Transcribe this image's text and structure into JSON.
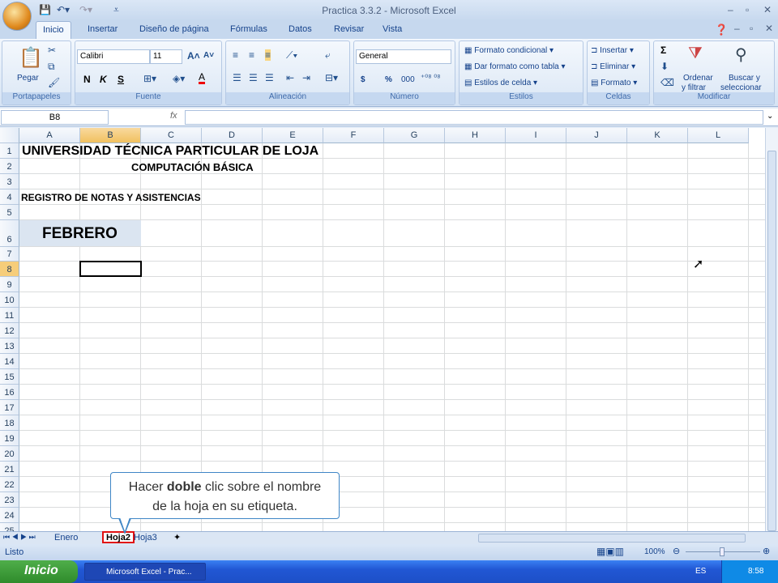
{
  "window": {
    "title": "Practica 3.3.2 - Microsoft Excel"
  },
  "tabs": [
    "Inicio",
    "Insertar",
    "Diseño de página",
    "Fórmulas",
    "Datos",
    "Revisar",
    "Vista"
  ],
  "ribbon": {
    "portapapeles": {
      "label": "Portapapeles",
      "pegar": "Pegar"
    },
    "fuente": {
      "label": "Fuente",
      "font": "Calibri",
      "size": "11",
      "bold": "N",
      "italic": "K",
      "underline": "S"
    },
    "alineacion": {
      "label": "Alineación"
    },
    "numero": {
      "label": "Número",
      "format": "General",
      "currency": "$",
      "percent": "%",
      "thousands": "000"
    },
    "estilos": {
      "label": "Estilos",
      "items": [
        "Formato condicional",
        "Dar formato como tabla",
        "Estilos de celda"
      ]
    },
    "celdas": {
      "label": "Celdas",
      "items": [
        "Insertar",
        "Eliminar",
        "Formato"
      ]
    },
    "modificar": {
      "label": "Modificar",
      "sum": "Σ",
      "ordenar1": "Ordenar",
      "ordenar2": "y filtrar",
      "buscar1": "Buscar y",
      "buscar2": "seleccionar"
    }
  },
  "formula_bar": {
    "name_box": "B8",
    "fx": "fx",
    "value": ""
  },
  "columns": [
    "A",
    "B",
    "C",
    "D",
    "E",
    "F",
    "G",
    "H",
    "I",
    "J",
    "K",
    "L"
  ],
  "rows": [
    "1",
    "2",
    "3",
    "4",
    "5",
    "6",
    "7",
    "8",
    "9",
    "10",
    "11",
    "12",
    "13",
    "14",
    "15",
    "16",
    "17",
    "18",
    "19",
    "20",
    "21",
    "22",
    "23",
    "24",
    "25"
  ],
  "cells": {
    "A1": "UNIVERSIDAD TÉCNICA PARTICULAR DE LOJA",
    "C2": "COMPUTACIÓN BÁSICA",
    "A4": "REGISTRO DE NOTAS Y ASISTENCIAS",
    "A6": "FEBRERO"
  },
  "sheets": [
    "Enero",
    "Hoja2",
    "Hoja3"
  ],
  "callout": {
    "pre": "Hacer ",
    "bold": "doble",
    "post": " clic sobre el nombre",
    "line2": "de la hoja en su etiqueta."
  },
  "status": {
    "text": "Listo",
    "zoom": "100%"
  },
  "taskbar": {
    "start": "Inicio",
    "task": "Microsoft Excel - Prac...",
    "lang": "ES",
    "time": "8:58"
  }
}
